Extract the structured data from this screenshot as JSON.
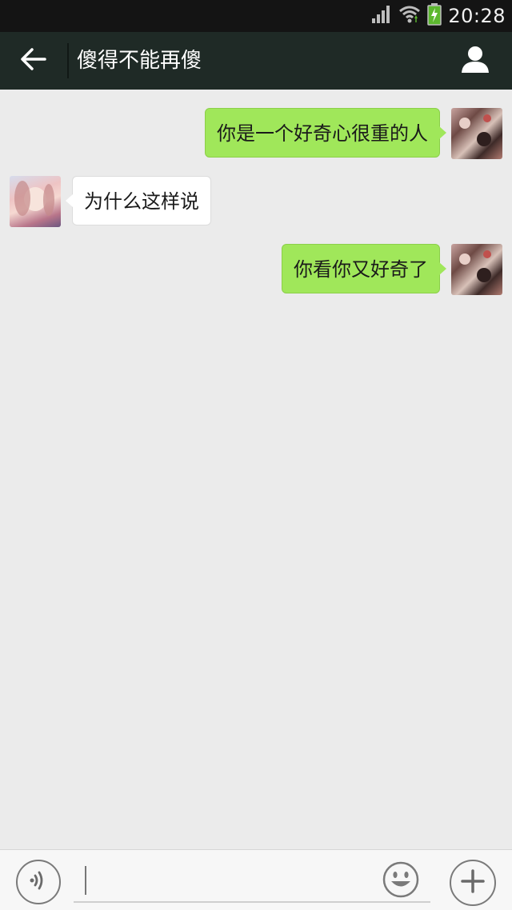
{
  "status_bar": {
    "time": "20:28",
    "icons": [
      "signal-icon",
      "wifi-icon",
      "battery-charging-icon"
    ]
  },
  "header": {
    "title": "傻得不能再傻",
    "back_icon": "arrow-left-icon",
    "profile_icon": "person-icon",
    "background": "#1f2a26"
  },
  "messages": [
    {
      "direction": "sent",
      "text": "你是一个好奇心很重的人"
    },
    {
      "direction": "received",
      "text": "为什么这样说"
    },
    {
      "direction": "sent",
      "text": "你看你又好奇了"
    }
  ],
  "input_bar": {
    "value": "",
    "voice_icon": "voice-icon",
    "emoji_icon": "smiley-icon",
    "plus_icon": "plus-icon"
  },
  "colors": {
    "sent_bubble": "#a0e75a",
    "received_bubble": "#ffffff",
    "chat_background": "#ebebeb"
  }
}
